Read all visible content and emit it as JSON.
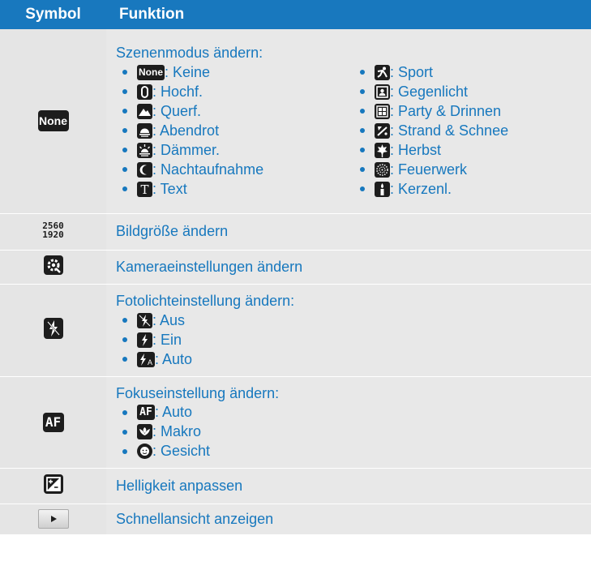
{
  "header": {
    "symbol": "Symbol",
    "function": "Funktion"
  },
  "scene": {
    "symbol_label": "None",
    "title": "Szenenmodus ändern:",
    "left": [
      {
        "icon": "none-badge",
        "badge": "None",
        "text": ": Keine"
      },
      {
        "icon": "portrait-icon",
        "text": ": Hochf."
      },
      {
        "icon": "landscape-icon",
        "text": ": Querf."
      },
      {
        "icon": "sunset-icon",
        "text": ": Abendrot"
      },
      {
        "icon": "dawn-icon",
        "text": ": Dämmer."
      },
      {
        "icon": "night-icon",
        "text": ": Nachtaufnahme"
      },
      {
        "icon": "text-icon",
        "text": ": Text"
      }
    ],
    "right": [
      {
        "icon": "sport-icon",
        "text": ": Sport"
      },
      {
        "icon": "backlight-icon",
        "text": ": Gegenlicht"
      },
      {
        "icon": "party-icon",
        "text": ": Party & Drinnen"
      },
      {
        "icon": "beach-snow-icon",
        "text": ": Strand & Schnee"
      },
      {
        "icon": "autumn-icon",
        "text": ": Herbst"
      },
      {
        "icon": "fireworks-icon",
        "text": ": Feuerwerk"
      },
      {
        "icon": "candle-icon",
        "text": ": Kerzenl."
      }
    ]
  },
  "size": {
    "top": "2560",
    "bottom": "1920",
    "text": "Bildgröße ändern"
  },
  "camera": {
    "text": "Kameraeinstellungen ändern"
  },
  "flash": {
    "title": "Fotolichteinstellung ändern:",
    "items": [
      {
        "icon": "flash-off-icon",
        "text": ": Aus"
      },
      {
        "icon": "flash-on-icon",
        "text": ": Ein"
      },
      {
        "icon": "flash-auto-icon",
        "text": ": Auto"
      }
    ]
  },
  "focus": {
    "symbol_label": "AF",
    "title": "Fokuseinstellung ändern:",
    "items": [
      {
        "icon": "af-icon",
        "badge": "AF",
        "text": ": Auto"
      },
      {
        "icon": "macro-icon",
        "text": ": Makro"
      },
      {
        "icon": "face-icon",
        "text": ": Gesicht"
      }
    ]
  },
  "brightness": {
    "text": "Helligkeit anpassen"
  },
  "quickview": {
    "text": "Schnellansicht anzeigen"
  }
}
